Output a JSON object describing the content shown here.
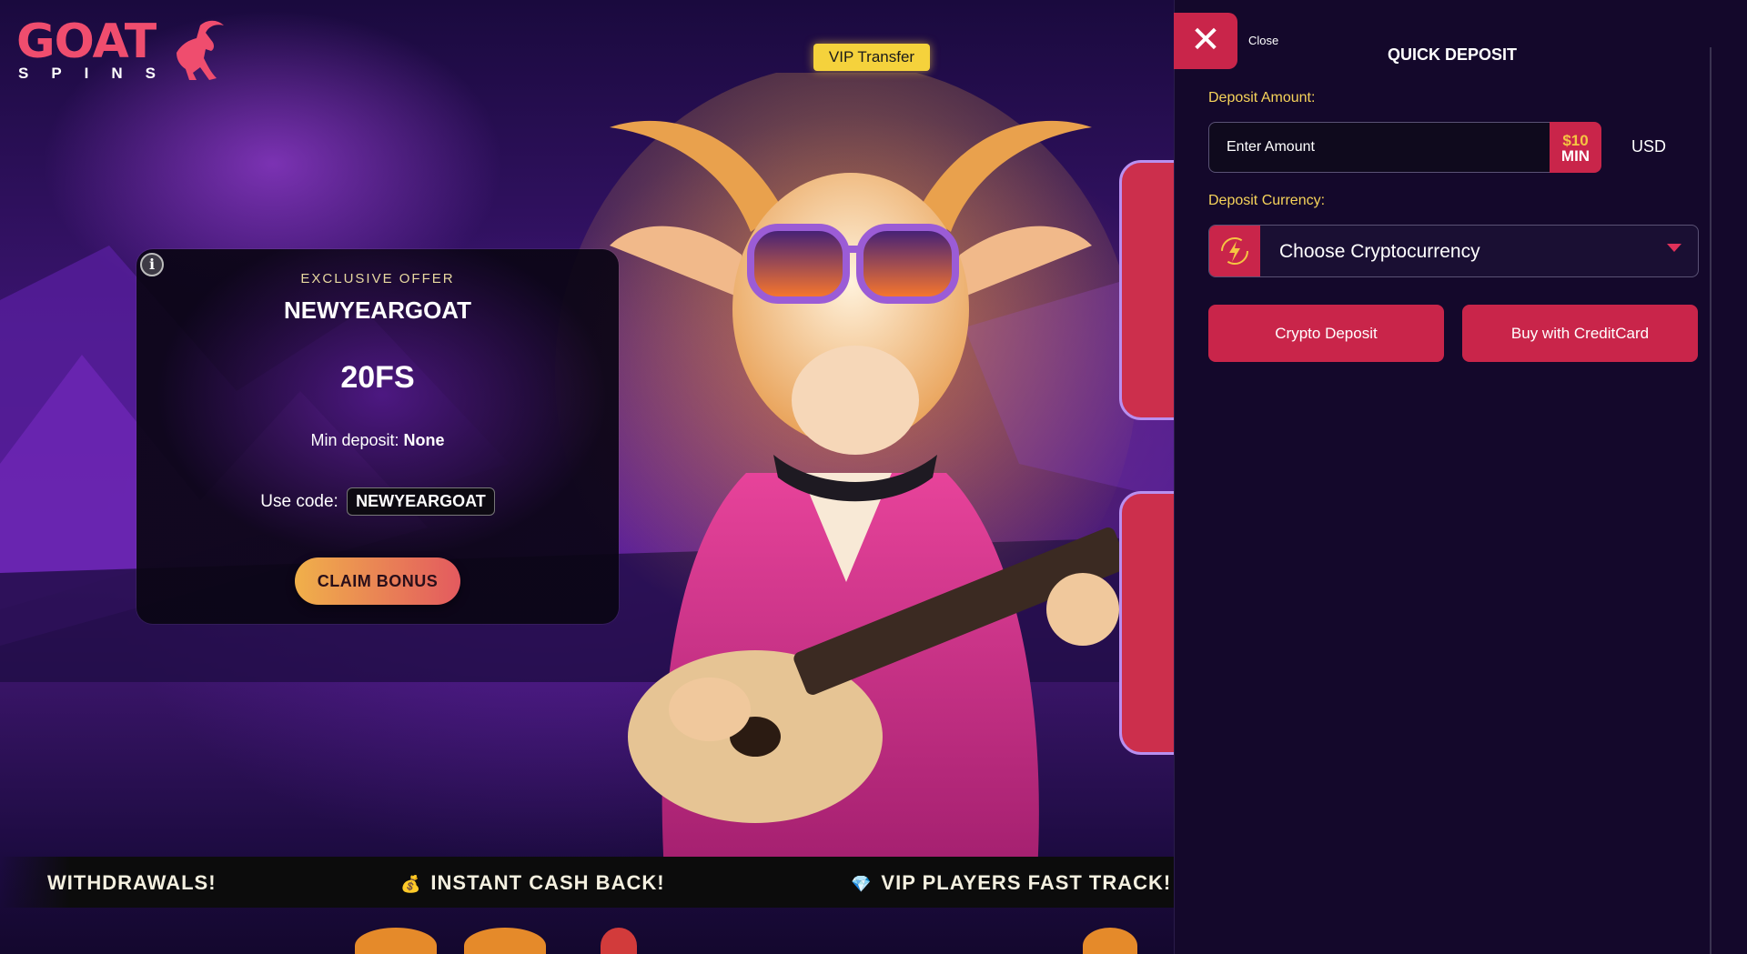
{
  "logo": {
    "brand": "GOAT",
    "sub": "SPINS"
  },
  "vip_transfer": "VIP Transfer",
  "offer": {
    "eyebrow": "EXCLUSIVE OFFER",
    "code_title": "NEWYEARGOAT",
    "amount": "20FS",
    "min_deposit_label": "Min deposit:",
    "min_deposit_value": "None",
    "use_code_label": "Use code:",
    "code": "NEWYEARGOAT",
    "claim_button": "CLAIM BONUS"
  },
  "ticker": [
    {
      "icon": "",
      "text": "WITHDRAWALS!"
    },
    {
      "icon": "money-bag-icon",
      "text": "INSTANT CASH BACK!"
    },
    {
      "icon": "diamond-icon",
      "text": "VIP PLAYERS FAST TRACK!"
    }
  ],
  "panel": {
    "close_label": "Close",
    "title": "QUICK DEPOSIT",
    "amount_label": "Deposit Amount:",
    "amount_placeholder": "Enter Amount",
    "min_badge_top": "$10",
    "min_badge_bottom": "MIN",
    "currency_code": "USD",
    "currency_label": "Deposit Currency:",
    "currency_select": "Choose Cryptocurrency",
    "crypto_deposit_button": "Crypto Deposit",
    "credit_card_button": "Buy with CreditCard"
  },
  "colors": {
    "accent": "#c9254a",
    "label_yellow": "#f6d35a",
    "panel_bg": "#14082b",
    "claim_start": "#f0b04a",
    "claim_end": "#e35a5f"
  }
}
